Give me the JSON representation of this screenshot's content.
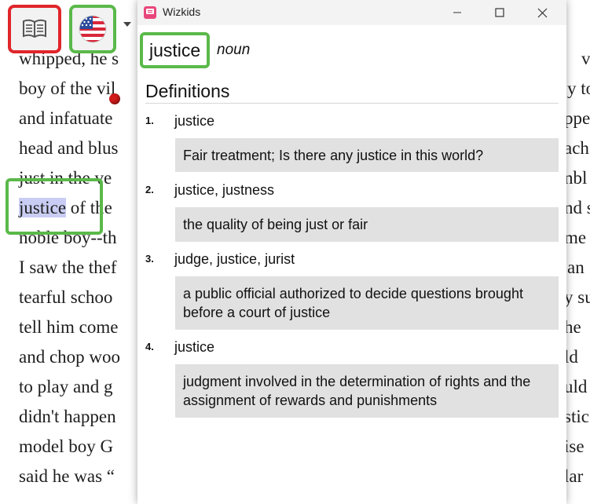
{
  "reader": {
    "lines": [
      {
        "left": "whipped, he s",
        "right": "v"
      },
      {
        "left": "boy of the vil",
        "right": "y to"
      },
      {
        "left": "and infatuate",
        "right": "ppe"
      },
      {
        "left": "head and blus",
        "right": "ach"
      },
      {
        "left": "just in the ve",
        "right": "nbl"
      },
      {
        "left_pre": "",
        "left_highlight": "justice",
        "left_post": " of the",
        "right": "nd s"
      },
      {
        "left": "noble boy--th",
        "right": "me"
      },
      {
        "left": "I saw the thef",
        "right": "an"
      },
      {
        "left": "tearful schoo",
        "right": "y su"
      },
      {
        "left": "tell him come",
        "right": "he"
      },
      {
        "left": "and chop woo",
        "right": "ld"
      },
      {
        "left": "to play and g",
        "right": "uld"
      },
      {
        "left": "didn't happen",
        "right": "stic"
      },
      {
        "left": "model boy G",
        "right": "ise"
      },
      {
        "left": "said he was “",
        "right": "lar"
      }
    ]
  },
  "toolbar": {
    "reader_icon": "open-book-icon",
    "flag_icon": "us-flag-icon",
    "dropdown_icon": "caret-down-icon"
  },
  "window": {
    "title": "Wizkids",
    "controls": [
      "minimize",
      "maximize",
      "close"
    ]
  },
  "entry": {
    "headword": "justice",
    "part_of_speech": "noun",
    "section_title": "Definitions",
    "definitions": [
      {
        "number": "1.",
        "terms": "justice",
        "gloss": "Fair treatment; Is there any justice in this world?"
      },
      {
        "number": "2.",
        "terms": "justice, justness",
        "gloss": "the quality of being just or fair"
      },
      {
        "number": "3.",
        "terms": "judge, justice, jurist",
        "gloss": "a public official authorized to decide questions brought before a court of justice"
      },
      {
        "number": "4.",
        "terms": "justice",
        "gloss": "judgment involved in the determination of rights and the assignment of rewards and punishments"
      }
    ]
  },
  "colors": {
    "highlight_green": "#5ab94a",
    "highlight_red": "#e0262b",
    "selection_blue": "#c9cdf3"
  }
}
